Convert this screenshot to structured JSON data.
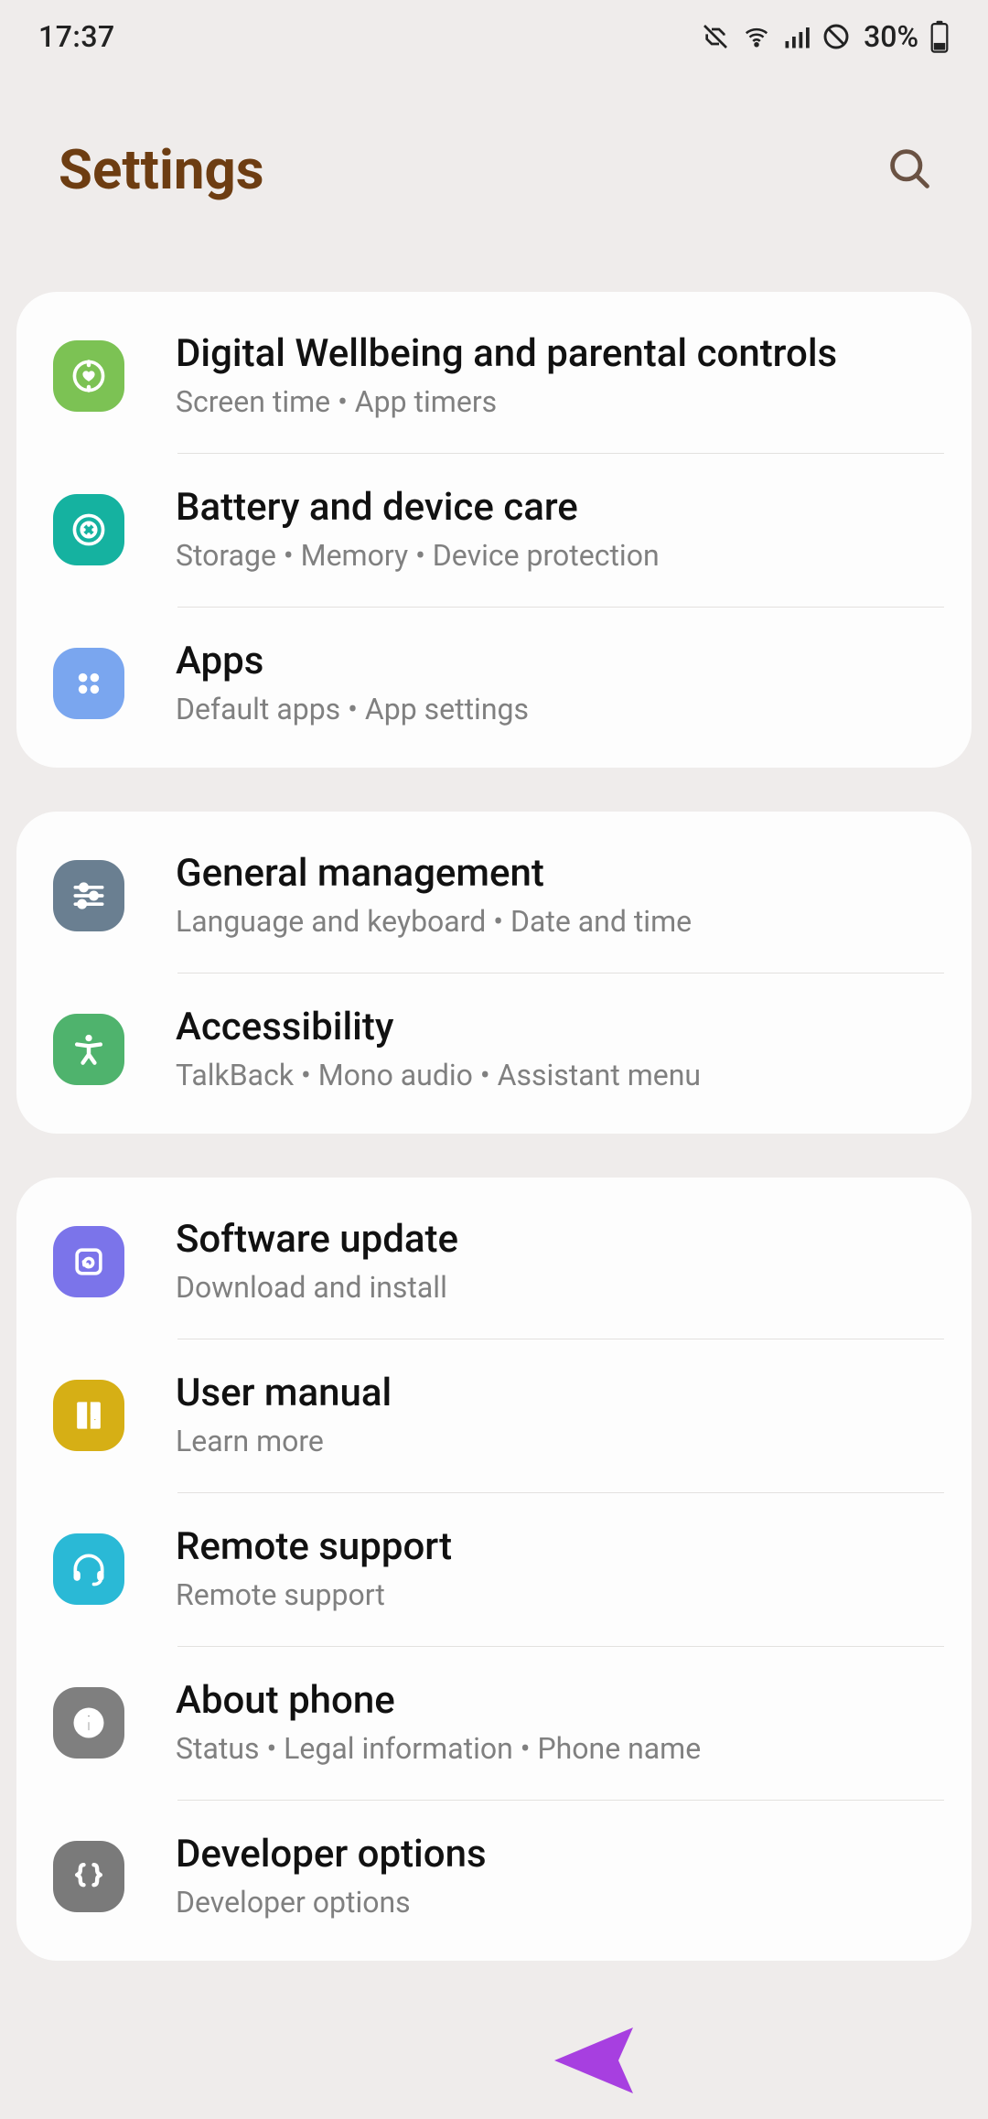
{
  "status": {
    "time": "17:37",
    "battery_percent": "30%"
  },
  "header": {
    "title": "Settings"
  },
  "groups": [
    {
      "rows": [
        {
          "icon": "wellbeing",
          "color": "bg-green1",
          "title": "Digital Wellbeing and parental controls",
          "subtitle": "Screen time  •  App timers"
        },
        {
          "icon": "battery",
          "color": "bg-teal",
          "title": "Battery and device care",
          "subtitle": "Storage  •  Memory  •  Device protection"
        },
        {
          "icon": "apps",
          "color": "bg-blue1",
          "title": "Apps",
          "subtitle": "Default apps  •  App settings"
        }
      ]
    },
    {
      "rows": [
        {
          "icon": "sliders",
          "color": "bg-slate",
          "title": "General management",
          "subtitle": "Language and keyboard  •  Date and time"
        },
        {
          "icon": "a11y",
          "color": "bg-green2",
          "title": "Accessibility",
          "subtitle": "TalkBack  •  Mono audio  •  Assistant menu"
        }
      ]
    },
    {
      "rows": [
        {
          "icon": "update",
          "color": "bg-violet",
          "title": "Software update",
          "subtitle": "Download and install"
        },
        {
          "icon": "manual",
          "color": "bg-gold",
          "title": "User manual",
          "subtitle": "Learn more"
        },
        {
          "icon": "headset",
          "color": "bg-cyan",
          "title": "Remote support",
          "subtitle": "Remote support"
        },
        {
          "icon": "info",
          "color": "bg-gray",
          "title": "About phone",
          "subtitle": "Status  •  Legal information  •  Phone name"
        },
        {
          "icon": "braces",
          "color": "bg-gray2",
          "title": "Developer options",
          "subtitle": "Developer options"
        }
      ]
    }
  ]
}
